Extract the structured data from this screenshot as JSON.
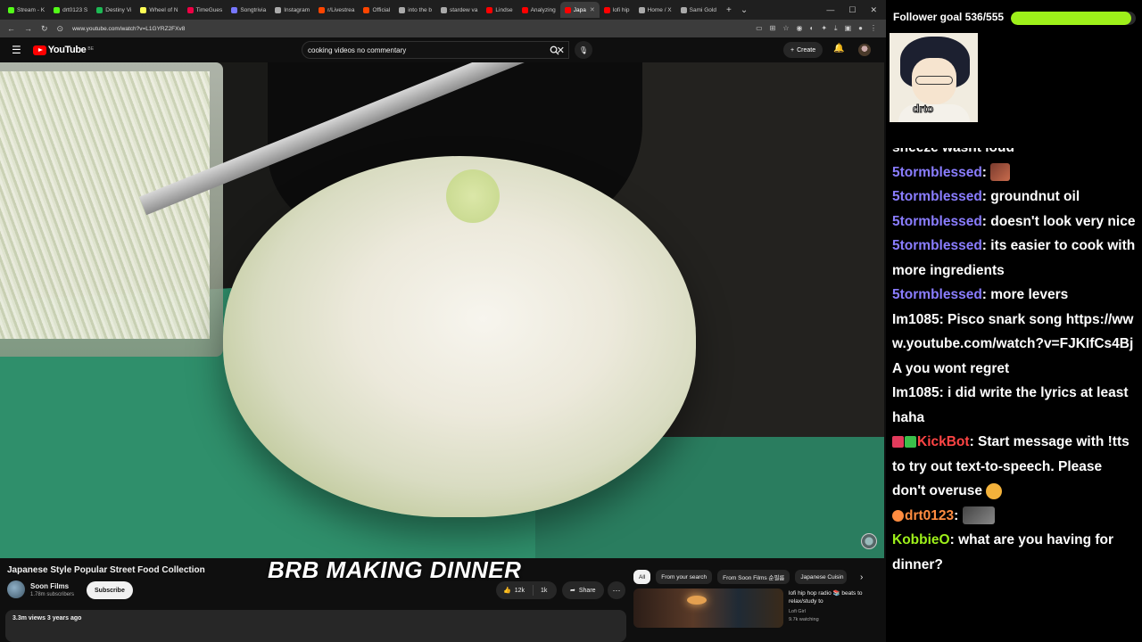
{
  "browser": {
    "tabs": [
      {
        "label": "Stream - K",
        "color": "#53fc18"
      },
      {
        "label": "drt0123 S",
        "color": "#53fc18"
      },
      {
        "label": "Destiny Vi",
        "color": "#1db954"
      },
      {
        "label": "Wheel of N",
        "color": "#ff5"
      },
      {
        "label": "TimeGues",
        "color": "#e04"
      },
      {
        "label": "Songtrivia",
        "color": "#77f"
      },
      {
        "label": "Instagram",
        "color": "#aaa"
      },
      {
        "label": "r/Livestrea",
        "color": "#ff4500"
      },
      {
        "label": "Official",
        "color": "#ff4500"
      },
      {
        "label": "into the b",
        "color": "#aaa"
      },
      {
        "label": "stardew va",
        "color": "#aaa"
      },
      {
        "label": "Lindse",
        "color": "#f00"
      },
      {
        "label": "Analyzing",
        "color": "#f00"
      },
      {
        "label": "Japa",
        "color": "#f00"
      },
      {
        "label": "lofi hip",
        "color": "#f00"
      },
      {
        "label": "Home / X",
        "color": "#aaa"
      },
      {
        "label": "Sami Gold",
        "color": "#aaa"
      }
    ],
    "active_tab_index": 13,
    "url": "www.youtube.com/watch?v=L1GYRZ2FXv8"
  },
  "youtube": {
    "logo_text": "YouTube",
    "logo_country": "BE",
    "search_value": "cooking videos no commentary",
    "create_label": "Create"
  },
  "video": {
    "title": "Japanese Style Popular Street Food Collection",
    "overlay_text": "BRB MAKING DINNER",
    "channel_name": "Soon Films",
    "channel_subs": "1.78m subscribers",
    "subscribe_label": "Subscribe",
    "likes": "12k",
    "dislikes": "1k",
    "share_label": "Share",
    "meta": "3.3m views  3 years ago"
  },
  "sidebar": {
    "chips": [
      "All",
      "From your search",
      "From Soon Films 순필름",
      "Japanese Cuisin"
    ],
    "reco": {
      "title": "lofi hip hop radio 📚 beats to relax/study to",
      "channel": "Lofi Girl",
      "watching": "9.7k watching"
    }
  },
  "overlay": {
    "follower_label": "Follower goal 536/555",
    "follower_current": 536,
    "follower_goal": 555,
    "cam_label": "drto",
    "accent": "#9ef01a"
  },
  "chat": {
    "partial_line": "sneeze wasnt loud",
    "messages": [
      {
        "user": "5tormblessed",
        "text": ""
      },
      {
        "user": "5tormblessed",
        "text": "groundnut oil"
      },
      {
        "user": "5tormblessed",
        "text": "doesn't look very nice"
      },
      {
        "user": "5tormblessed",
        "text": "its easier to cook with more ingredients"
      },
      {
        "user": "5tormblessed",
        "text": "more levers"
      },
      {
        "user": "Im1085",
        "text": "Pisco snark song https://www.youtube.com/watch?v=FJKIfCs4BjA you wont regret"
      },
      {
        "user": "Im1085",
        "text": "i did write the lyrics at least haha"
      },
      {
        "user": "KickBot",
        "text": "Start message with !tts to try out text-to-speech. Please don't overuse"
      },
      {
        "user": "drt0123",
        "text": ""
      },
      {
        "user": "KobbieO",
        "text": "what are you having for dinner?"
      }
    ]
  }
}
